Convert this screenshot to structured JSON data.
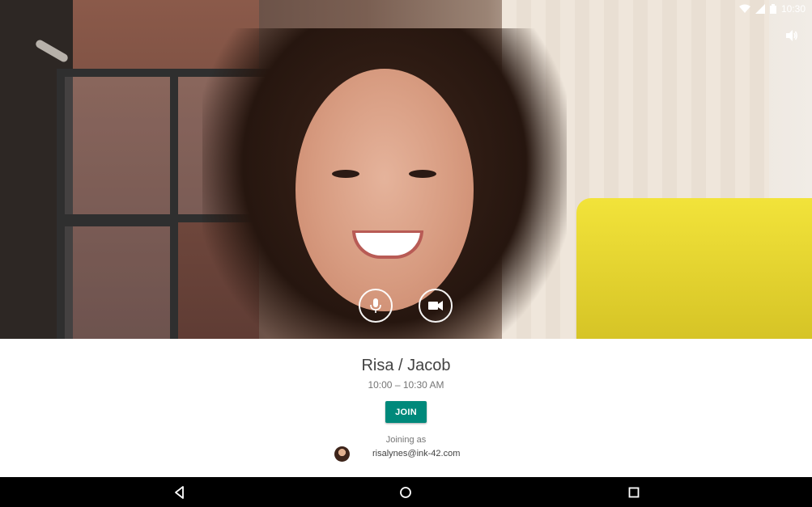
{
  "status_bar": {
    "time": "10:30",
    "icons": [
      "wifi-icon",
      "signal-icon",
      "battery-icon"
    ]
  },
  "camera_preview": {
    "controls": [
      {
        "name": "microphone-button",
        "icon": "microphone-icon"
      },
      {
        "name": "camera-button",
        "icon": "video-camera-icon"
      }
    ],
    "volume_icon": "volume-icon"
  },
  "meeting": {
    "title": "Risa / Jacob",
    "time": "10:00 – 10:30 AM",
    "join_label": "JOIN",
    "joining_as_label": "Joining as",
    "email": "risalynes@ink-42.com"
  },
  "nav_bar": {
    "buttons": [
      "back-icon",
      "home-icon",
      "recents-icon"
    ]
  },
  "colors": {
    "accent": "#00897b",
    "panel_bg": "#ffffff",
    "nav_bg": "#000000"
  }
}
